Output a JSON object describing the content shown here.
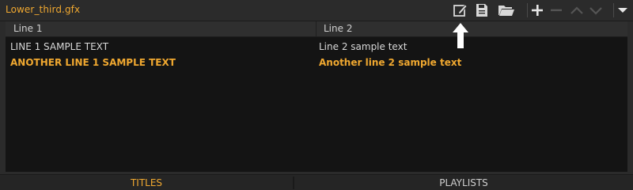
{
  "window": {
    "file_title": "Lower_third.gfx"
  },
  "toolbar": {
    "buttons": [
      {
        "name": "edit",
        "icon": "edit-icon",
        "enabled": true
      },
      {
        "name": "save",
        "icon": "save-icon",
        "enabled": true
      },
      {
        "name": "open",
        "icon": "folder-open-icon",
        "enabled": true
      },
      {
        "name": "add",
        "icon": "plus-icon",
        "enabled": true
      },
      {
        "name": "remove",
        "icon": "minus-icon",
        "enabled": false
      },
      {
        "name": "move-up",
        "icon": "chevron-up-icon",
        "enabled": false
      },
      {
        "name": "move-down",
        "icon": "chevron-down-icon",
        "enabled": false
      },
      {
        "name": "menu",
        "icon": "caret-down-icon",
        "enabled": true
      }
    ]
  },
  "table": {
    "columns": [
      "Line 1",
      "Line 2"
    ],
    "rows": [
      {
        "line1": "LINE 1 SAMPLE TEXT",
        "line2": "Line 2 sample text",
        "state": "normal"
      },
      {
        "line1": "ANOTHER LINE 1 SAMPLE TEXT",
        "line2": "Another line 2 sample text",
        "state": "highlighted"
      }
    ]
  },
  "tabs": [
    {
      "label": "TITLES",
      "active": true
    },
    {
      "label": "PLAYLISTS",
      "active": false
    }
  ],
  "colors": {
    "accent": "#f0a830",
    "background": "#2b2b2b",
    "table_background": "#141414",
    "text": "#d8d8d8"
  }
}
